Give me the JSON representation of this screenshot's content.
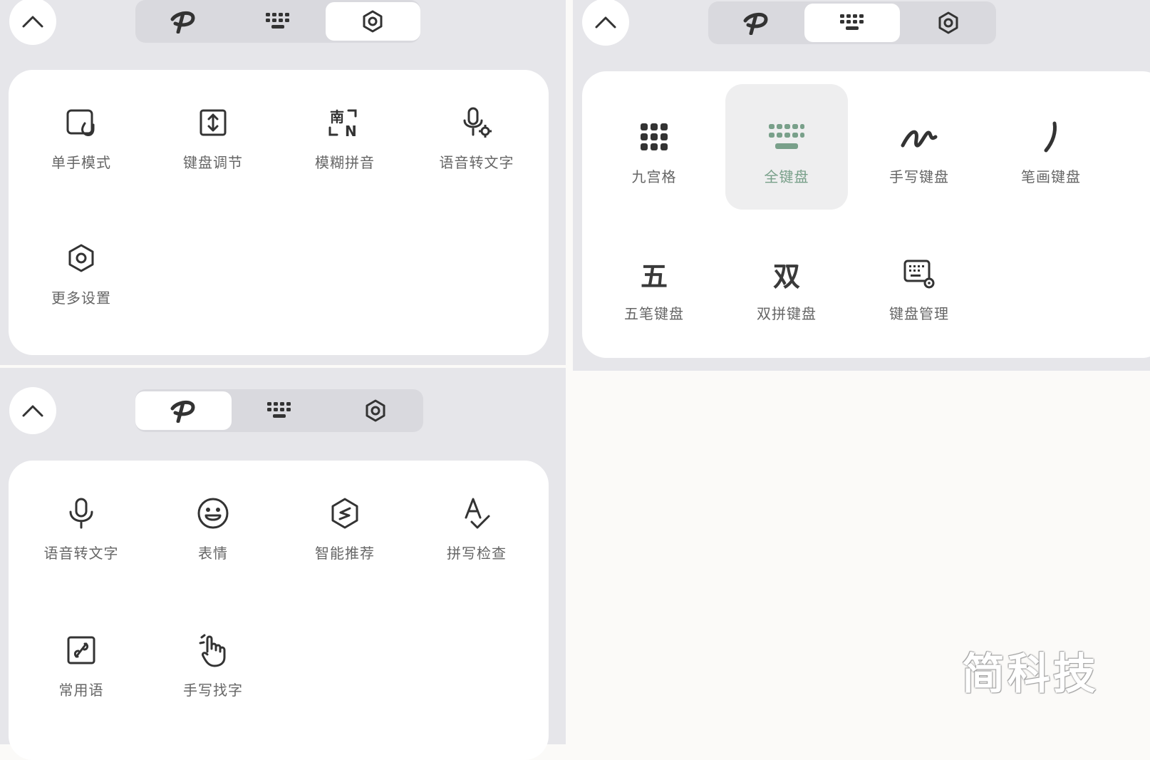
{
  "panels": {
    "settings": {
      "tabs": [
        "p-logo-icon",
        "keyboard-icon",
        "gear-icon"
      ],
      "active_tab": 2,
      "items": [
        {
          "label": "单手模式",
          "icon": "one-hand-icon"
        },
        {
          "label": "键盘调节",
          "icon": "resize-icon"
        },
        {
          "label": "模糊拼音",
          "icon": "fuzzy-pinyin-icon"
        },
        {
          "label": "语音转文字",
          "icon": "voice-settings-icon"
        },
        {
          "label": "更多设置",
          "icon": "gear-icon"
        }
      ]
    },
    "keyboards": {
      "tabs": [
        "p-logo-icon",
        "keyboard-icon",
        "gear-icon"
      ],
      "active_tab": 1,
      "items": [
        {
          "label": "九宫格",
          "icon": "nine-grid-icon"
        },
        {
          "label": "全键盘",
          "icon": "full-keyboard-icon",
          "selected": true
        },
        {
          "label": "手写键盘",
          "icon": "handwriting-icon"
        },
        {
          "label": "笔画键盘",
          "icon": "stroke-icon"
        },
        {
          "label": "五笔键盘",
          "icon": "wubi-icon",
          "glyph": "五"
        },
        {
          "label": "双拼键盘",
          "icon": "shuangpin-icon",
          "glyph": "双"
        },
        {
          "label": "键盘管理",
          "icon": "keyboard-manage-icon"
        }
      ],
      "accent_color": "#79a08a"
    },
    "features": {
      "tabs": [
        "p-logo-icon",
        "keyboard-icon",
        "gear-icon"
      ],
      "active_tab": 0,
      "items": [
        {
          "label": "语音转文字",
          "icon": "microphone-icon"
        },
        {
          "label": "表情",
          "icon": "emoji-icon"
        },
        {
          "label": "智能推荐",
          "icon": "smart-recommend-icon"
        },
        {
          "label": "拼写检查",
          "icon": "spell-check-icon"
        },
        {
          "label": "常用语",
          "icon": "phrases-icon"
        },
        {
          "label": "手写找字",
          "icon": "hand-write-find-icon"
        }
      ]
    }
  },
  "watermark": "简科技"
}
